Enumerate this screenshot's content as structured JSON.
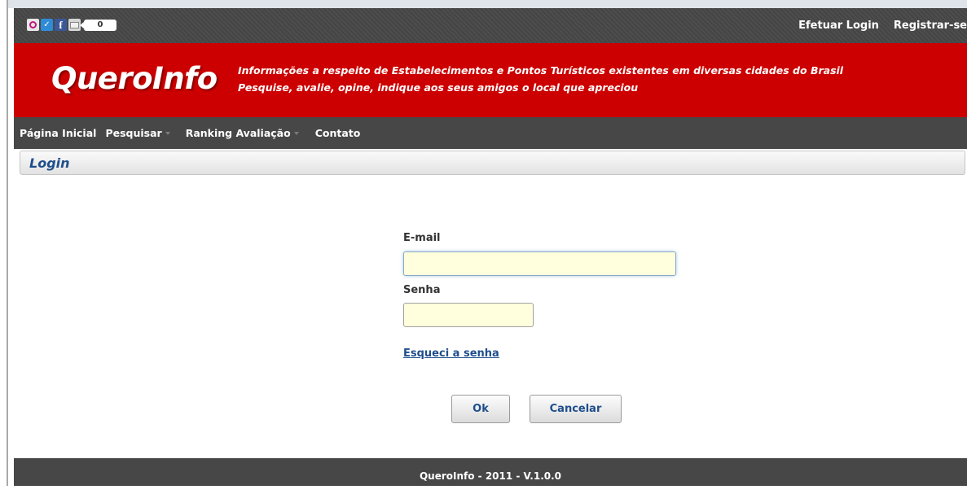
{
  "social": {
    "icons": [
      "orkut-icon",
      "twitter-icon",
      "facebook-icon",
      "mail-icon"
    ],
    "count": "0"
  },
  "top_links": {
    "login": "Efetuar Login",
    "register": "Registrar-se"
  },
  "banner": {
    "logo": "QueroInfo",
    "tagline_line1": "Informações a respeito de Estabelecimentos e Pontos Turísticos existentes em diversas cidades do Brasil",
    "tagline_line2": "Pesquise, avalie, opine, indique aos seus amigos o local que apreciou"
  },
  "nav": {
    "home": "Página Inicial",
    "search": "Pesquisar",
    "ranking": "Ranking Avaliação",
    "contact": "Contato"
  },
  "panel": {
    "title": "Login"
  },
  "form": {
    "email_label": "E-mail",
    "email_value": "",
    "password_label": "Senha",
    "password_value": "",
    "forgot_link": "Esqueci a senha",
    "ok_button": "Ok",
    "cancel_button": "Cancelar"
  },
  "footer": {
    "text": "QueroInfo - 2011 - V.1.0.0"
  },
  "colors": {
    "banner_red": "#cc0000",
    "bar_dark": "#474747",
    "link_blue": "#1f4e8c",
    "input_fill": "#ffffdd"
  }
}
